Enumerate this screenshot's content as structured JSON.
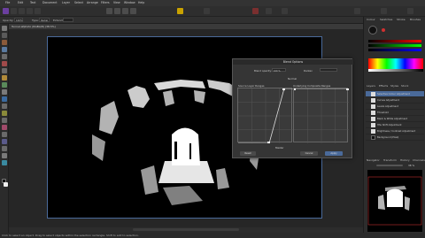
{
  "app": {
    "menu": [
      "File",
      "Edit",
      "Text",
      "Document",
      "Layer",
      "Select",
      "Arrange",
      "Filters",
      "View",
      "Window",
      "Help"
    ]
  },
  "context": {
    "opacity_label": "Opacity:",
    "opacity_value": "100%",
    "blend_label": "Type:",
    "blend_value": "Radial",
    "extend_label": "Extend:"
  },
  "document": {
    "tab_title": "Tunnel.afphoto (RGBA/8) (38.5%)"
  },
  "right_panel": {
    "top_tabs": [
      "Colour",
      "Swatches",
      "Stroke",
      "Brushes"
    ],
    "layer_tabs": [
      "Layers",
      "Effects",
      "Styles",
      "Stock"
    ],
    "layers": [
      "Selective Colour Adjustment",
      "Curves Adjustment",
      "Levels Adjustment",
      "Threshold",
      "Black & White Adjustment",
      "HSL Shift Adjustment",
      "Brightness / Contrast Adjustment",
      "Background (Pixel)"
    ],
    "navigator_tabs": [
      "Navigator",
      "Transform",
      "History",
      "Channels"
    ],
    "zoom_value": "38 %"
  },
  "dialog": {
    "title": "Blend Options",
    "opacity_label": "Blend opacity:",
    "opacity_value": "100 %",
    "blend_mode_label": "Darken",
    "source_label": "Source Layer Ranges",
    "underlying_label": "Underlying Composite Ranges",
    "mode_label": "Normal",
    "channel_label": "Master",
    "buttons": [
      "Reset",
      "Cancel",
      "Apply"
    ]
  },
  "status": {
    "text": "Click to select an object. Drag to select objects within the selection rectangle. Shift to add to selection."
  },
  "colors": {
    "accent": "#4a6a9a",
    "bg": "#2c2c2c",
    "photo": "#000000"
  }
}
